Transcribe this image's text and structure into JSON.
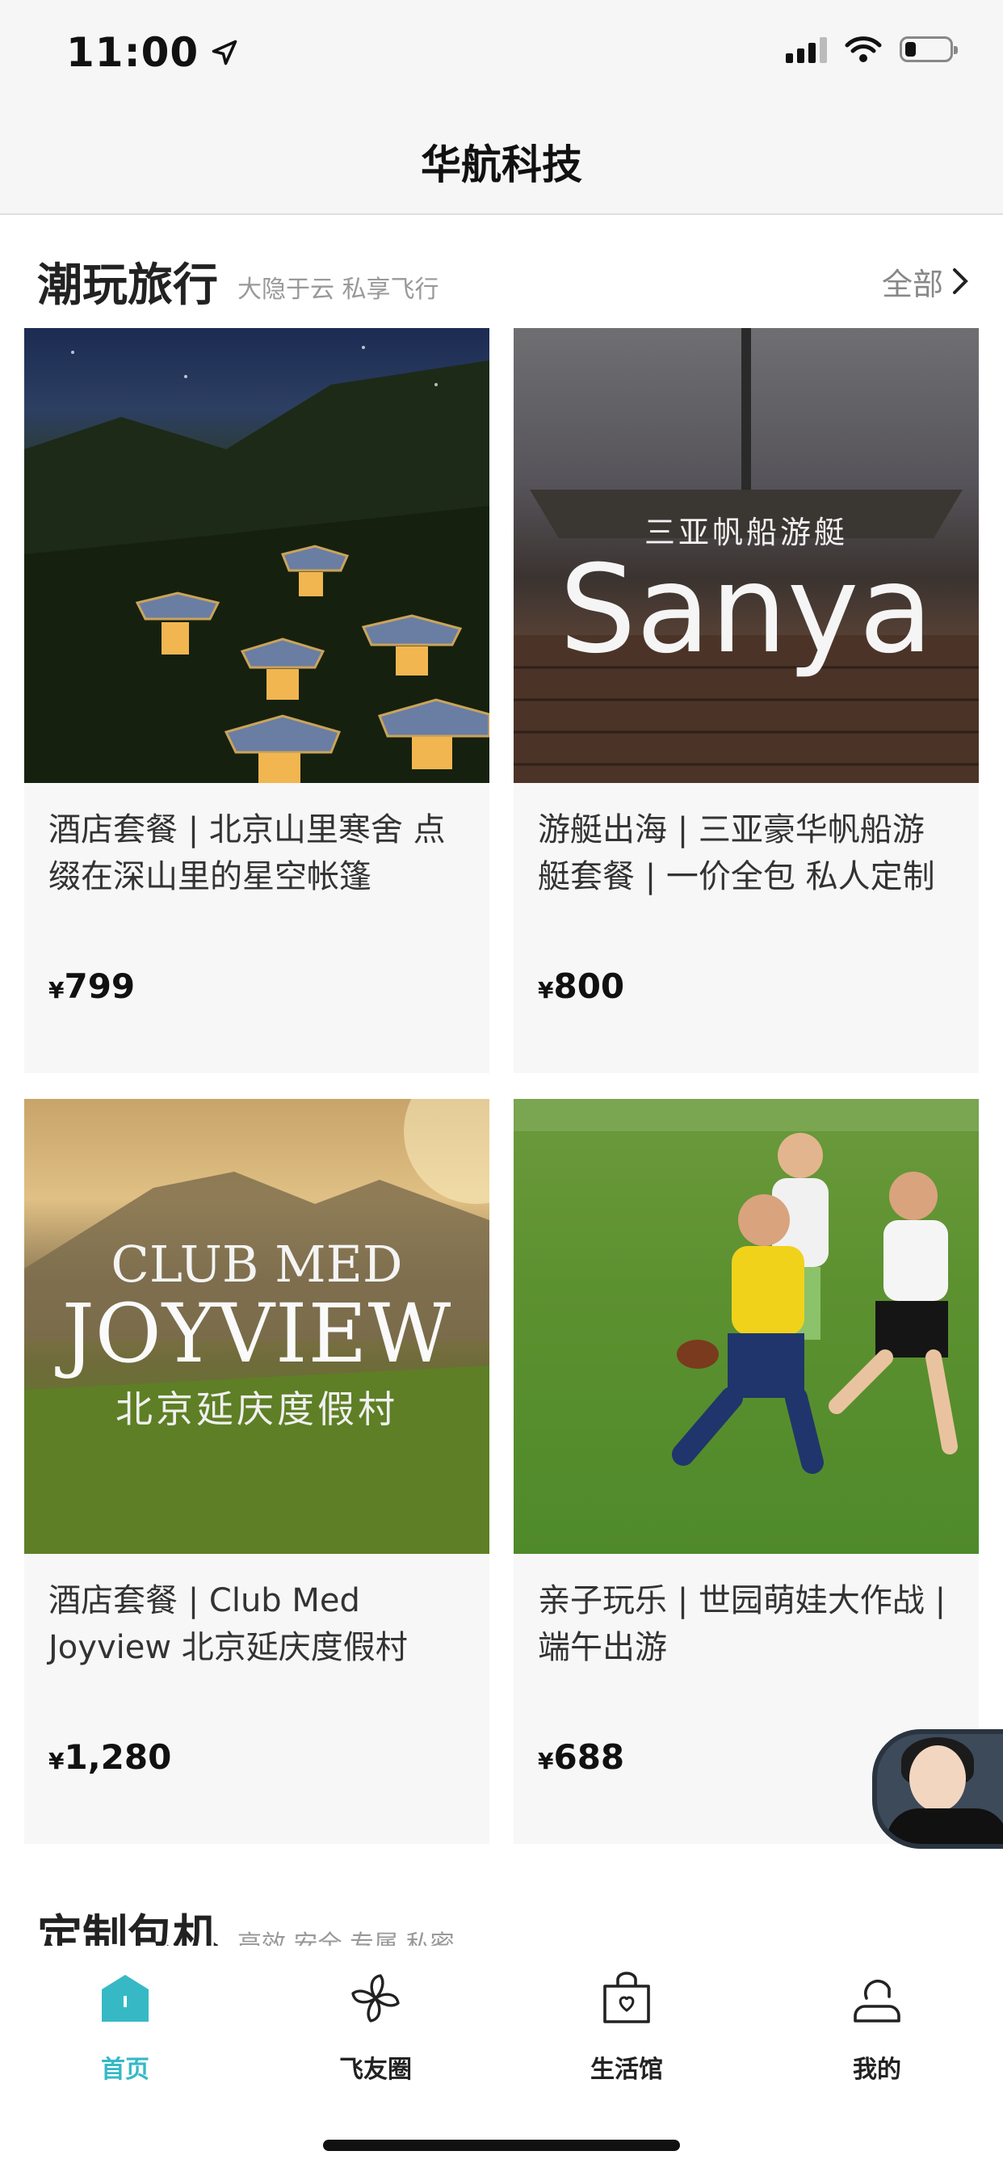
{
  "status_bar": {
    "time": "11:00",
    "battery_level": 0.25
  },
  "nav": {
    "title": "华航科技"
  },
  "section1": {
    "title": "潮玩旅行",
    "subtitle": "大隐于云 私享飞行",
    "more": "全部"
  },
  "cards": [
    {
      "title": "酒店套餐 | 北京山里寒舍 点缀在深山里的星空帐篷",
      "currency": "¥",
      "price": "799",
      "image": "night-tent-camp-image"
    },
    {
      "title": "游艇出海 | 三亚豪华帆船游艇套餐 | 一价全包 私人定制",
      "currency": "¥",
      "price": "800",
      "image": "sailing-yacht-image",
      "image_text_cn": "三亚帆船游艇",
      "image_text_en": "Sanya"
    },
    {
      "title": "酒店套餐 | Club Med Joyview 北京延庆度假村",
      "currency": "¥",
      "price": "1,280",
      "image": "club-med-resort-image",
      "image_text_1": "CLUB MED",
      "image_text_2": "JOYVIEW",
      "image_text_3": "北京延庆度假村"
    },
    {
      "title": "亲子玩乐 | 世园萌娃大作战 | 端午出游",
      "currency": "¥",
      "price": "688",
      "image": "kids-football-image"
    }
  ],
  "section2": {
    "title": "定制包机",
    "subtitle": "高效 安全 专属 私密"
  },
  "tabs": [
    {
      "label": "首页",
      "icon": "home-icon",
      "active": true
    },
    {
      "label": "飞友圈",
      "icon": "pinwheel-icon",
      "active": false
    },
    {
      "label": "生活馆",
      "icon": "shopping-bag-icon",
      "active": false
    },
    {
      "label": "我的",
      "icon": "profile-icon",
      "active": false
    }
  ],
  "colors": {
    "accent": "#36b9c5",
    "card_bg": "#f7f7f7"
  }
}
